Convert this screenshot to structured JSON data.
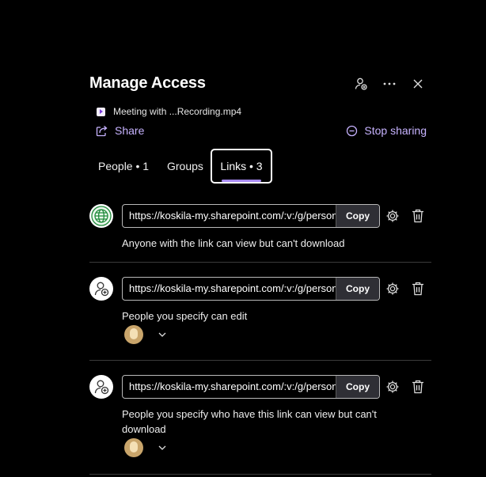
{
  "header": {
    "title": "Manage Access"
  },
  "file": {
    "name": "Meeting with ...Recording.mp4"
  },
  "actions": {
    "share": "Share",
    "stop_sharing": "Stop sharing"
  },
  "tabs": [
    {
      "label": "People • 1"
    },
    {
      "label": "Groups"
    },
    {
      "label": "Links • 3"
    }
  ],
  "links": [
    {
      "url": "https://koskila-my.sharepoint.com/:v:/g/personal/",
      "copy": "Copy",
      "description": "Anyone with the link can view but can't download",
      "icon": "globe-icon"
    },
    {
      "url": "https://koskila-my.sharepoint.com/:v:/g/personal/",
      "copy": "Copy",
      "description": "People you specify can edit",
      "icon": "people-link-icon"
    },
    {
      "url": "https://koskila-my.sharepoint.com/:v:/g/personal/",
      "copy": "Copy",
      "description": "People you specify who have this link can view but can't download",
      "icon": "people-link-icon"
    }
  ],
  "colors": {
    "accent": "#c7b3ff",
    "tab_underline": "#a98cf5",
    "globe": "#1f8a3a"
  }
}
